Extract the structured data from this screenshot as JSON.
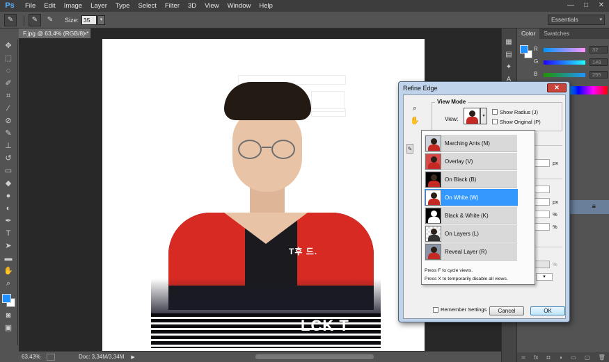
{
  "menubar": {
    "logo": "Ps",
    "items": [
      "File",
      "Edit",
      "Image",
      "Layer",
      "Type",
      "Select",
      "Filter",
      "3D",
      "View",
      "Window",
      "Help"
    ],
    "window_controls": [
      "—",
      "□",
      "✕"
    ]
  },
  "options": {
    "size_label": "Size:",
    "size_value": "35",
    "workspace": "Essentials"
  },
  "document": {
    "tab_title": "F.jpg @ 63,4% (RGB/8) *",
    "canvas_logo_text": "T후 드.",
    "canvas_bottom_text": "LCK T"
  },
  "status": {
    "zoom": "63,43%",
    "doc_size": "Doc: 3,34M/3,34M"
  },
  "panels": {
    "tabs": [
      "Color",
      "Swatches"
    ],
    "rows": [
      {
        "label": "R",
        "value": "32"
      },
      {
        "label": "G",
        "value": "148"
      },
      {
        "label": "B",
        "value": "255"
      }
    ]
  },
  "refine_edge": {
    "title": "Refine Edge",
    "close": "✕",
    "view_mode_label": "View Mode",
    "view_label": "View:",
    "show_radius": "Show Radius (J)",
    "show_original": "Show Original (P)",
    "px_unit": "px",
    "percent_unit": "%",
    "views": [
      {
        "label": "Marching Ants (M)",
        "bg": "#cfd4dc",
        "selected": false
      },
      {
        "label": "Overlay (V)",
        "bg": "#d64a4a",
        "selected": false
      },
      {
        "label": "On Black (B)",
        "bg": "#000000",
        "selected": false
      },
      {
        "label": "On White (W)",
        "bg": "#ffffff",
        "selected": true
      },
      {
        "label": "Black & White (K)",
        "bg": "#000000",
        "selected": false
      },
      {
        "label": "On Layers (L)",
        "bg": "#e8e8e8",
        "selected": false
      },
      {
        "label": "Reveal Layer (R)",
        "bg": "#8a96a8",
        "selected": false
      }
    ],
    "hint1": "Press F to cycle views.",
    "hint2": "Press X to temporarily disable all views.",
    "remember_label": "Remember Settings",
    "cancel_label": "Cancel",
    "ok_label": "OK"
  },
  "colors": {
    "accent": "#3399ff",
    "foreground": "#1e90ff"
  }
}
